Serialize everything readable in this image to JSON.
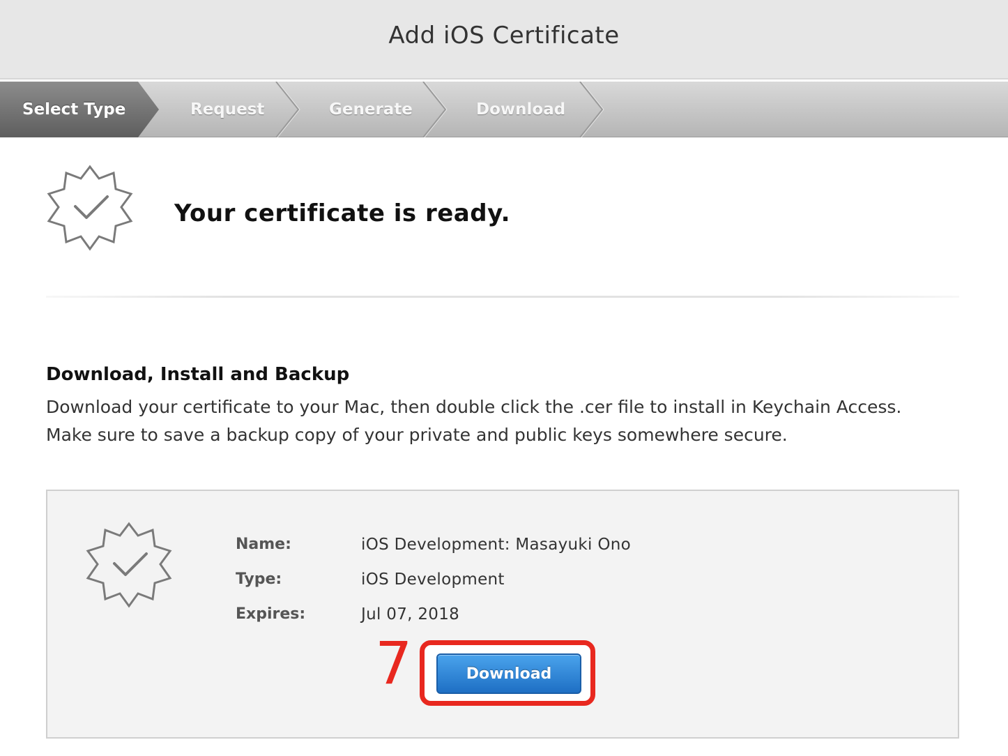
{
  "header": {
    "title": "Add iOS Certificate"
  },
  "steps": [
    {
      "label": "Select Type",
      "active": true
    },
    {
      "label": "Request",
      "active": false
    },
    {
      "label": "Generate",
      "active": false
    },
    {
      "label": "Download",
      "active": false
    }
  ],
  "status": {
    "icon": "certificate-badge-icon",
    "message": "Your certificate is ready."
  },
  "instructions": {
    "heading": "Download, Install and Backup",
    "body": "Download your certificate to your Mac, then double click the .cer file to install in Keychain Access. Make sure to save a backup copy of your private and public keys somewhere secure."
  },
  "certificate": {
    "icon": "certificate-badge-icon",
    "fields": [
      {
        "label": "Name:",
        "value": "iOS Development: Masayuki Ono"
      },
      {
        "label": "Type:",
        "value": "iOS Development"
      },
      {
        "label": "Expires:",
        "value": "Jul 07, 2018"
      }
    ],
    "download_label": "Download"
  },
  "annotation": {
    "step_number": "7"
  },
  "colors": {
    "accent": "#2a7fd4",
    "annotation": "#e8281f",
    "header_bg": "#e7e7e7"
  }
}
